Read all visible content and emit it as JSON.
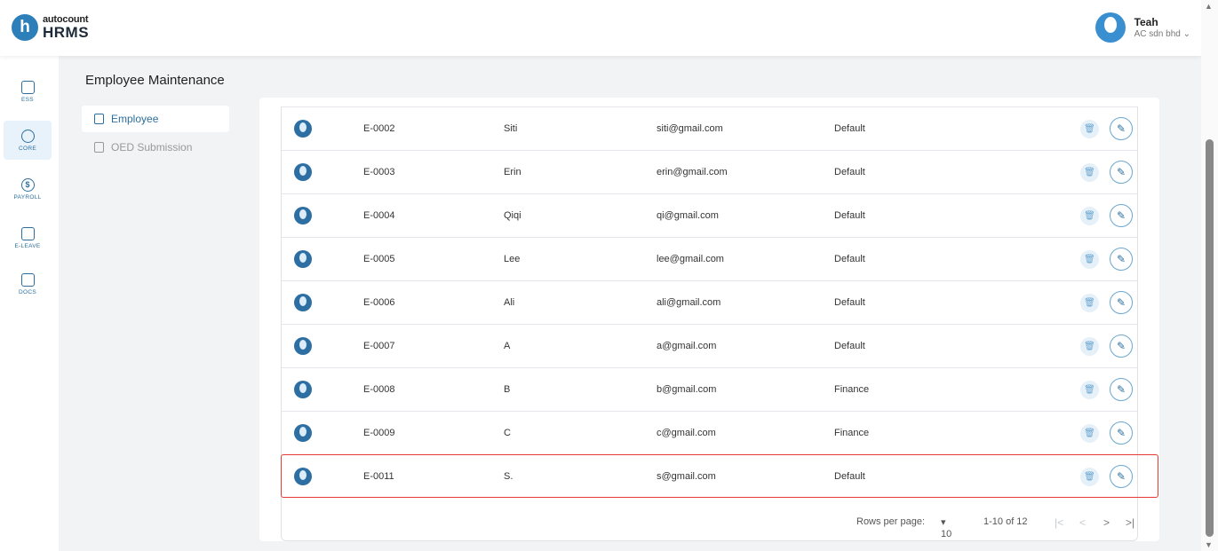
{
  "app": {
    "logo_small": "autocount",
    "logo_big": "HRMS",
    "logo_mark": "h"
  },
  "user": {
    "name": "Teah",
    "company": "AC sdn bhd"
  },
  "sidebar": {
    "items": [
      {
        "label": "ESS",
        "icon": "ess-icon",
        "active": false
      },
      {
        "label": "CORE",
        "icon": "cube-icon",
        "active": true
      },
      {
        "label": "PAYROLL",
        "icon": "dollar-icon",
        "active": false
      },
      {
        "label": "E-LEAVE",
        "icon": "calendar-icon",
        "active": false
      },
      {
        "label": "DOCS",
        "icon": "document-icon",
        "active": false
      }
    ]
  },
  "page": {
    "title": "Employee Maintenance"
  },
  "submenu": [
    {
      "label": "Employee",
      "active": true
    },
    {
      "label": "OED Submission",
      "active": false
    }
  ],
  "table": {
    "rows": [
      {
        "code": "E-0002",
        "name": "Siti",
        "email": "siti@gmail.com",
        "group": "Default"
      },
      {
        "code": "E-0003",
        "name": "Erin",
        "email": "erin@gmail.com",
        "group": "Default"
      },
      {
        "code": "E-0004",
        "name": "Qiqi",
        "email": "qi@gmail.com",
        "group": "Default"
      },
      {
        "code": "E-0005",
        "name": "Lee",
        "email": "lee@gmail.com",
        "group": "Default"
      },
      {
        "code": "E-0006",
        "name": "Ali",
        "email": "ali@gmail.com",
        "group": "Default"
      },
      {
        "code": "E-0007",
        "name": "A",
        "email": "a@gmail.com",
        "group": "Default"
      },
      {
        "code": "E-0008",
        "name": "B",
        "email": "b@gmail.com",
        "group": "Finance"
      },
      {
        "code": "E-0009",
        "name": "C",
        "email": "c@gmail.com",
        "group": "Finance"
      },
      {
        "code": "E-0011",
        "name": "S.",
        "email": "s@gmail.com",
        "group": "Default"
      }
    ]
  },
  "pager": {
    "rows_per_page_label": "Rows per page:",
    "rows_per_page_value": "10",
    "range": "1-10 of 12",
    "first": "|<",
    "prev": "<",
    "next": ">",
    "last": ">|"
  },
  "colors": {
    "accent": "#2c6f9e",
    "highlight_border": "#e53935"
  }
}
